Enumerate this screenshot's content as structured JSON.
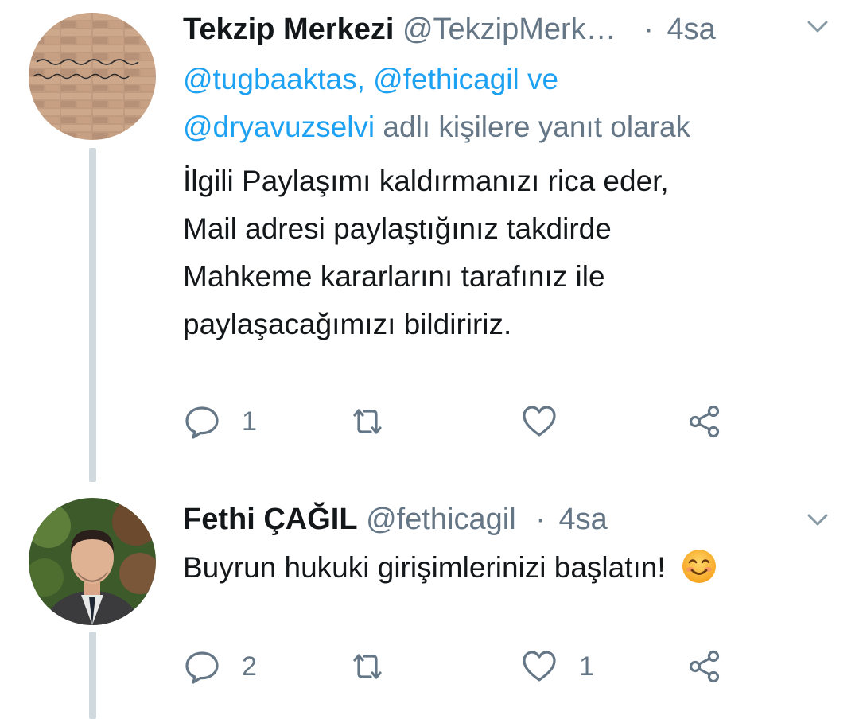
{
  "tweets": [
    {
      "display_name": "Tekzip Merkezi",
      "handle": "@TekzipMerk…",
      "separator": "·",
      "time": "4sa",
      "reply_to": {
        "mention1": "@tugbaaktas,",
        "mention2": "@fethicagil",
        "connector": "ve",
        "mention3": "@dryavuzselvi",
        "suffix": "adlı kişilere yanıt olarak"
      },
      "text_lines": [
        "İlgili Paylaşımı kaldırmanızı rica eder,",
        "Mail adresi paylaştığınız takdirde",
        "Mahkeme kararlarını tarafınız ile",
        "paylaşacağımızı bildiririz."
      ],
      "stats": {
        "replies": "1",
        "retweets": "",
        "likes": ""
      }
    },
    {
      "display_name": "Fethi ÇAĞIL",
      "handle": "@fethicagil",
      "separator": "·",
      "time": "4sa",
      "text": "Buyrun hukuki girişimlerinizi başlatın!",
      "stats": {
        "replies": "2",
        "retweets": "",
        "likes": "1"
      }
    }
  ],
  "icons": {
    "reply": "reply-icon",
    "retweet": "retweet-icon",
    "like": "like-icon",
    "share": "share-icon",
    "menu": "chevron-down-icon",
    "emoji": "smiling-face-emoji"
  },
  "colors": {
    "link": "#1da1f2",
    "secondary_text": "#657786",
    "thread_line": "#cfd9de"
  }
}
